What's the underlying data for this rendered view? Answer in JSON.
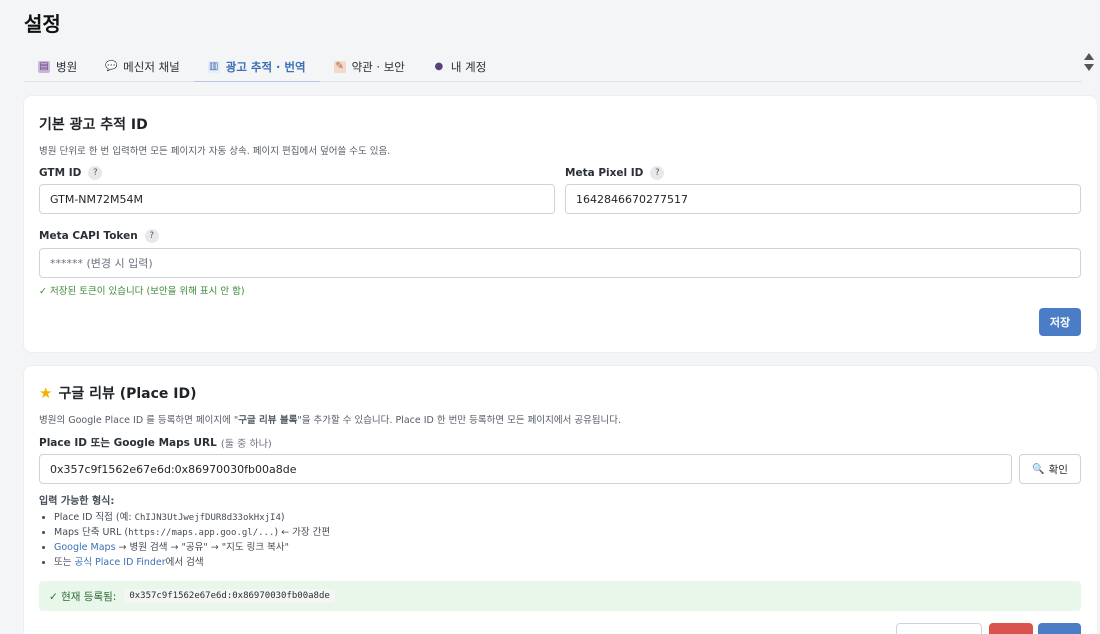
{
  "page": {
    "title": "설정"
  },
  "tabs": [
    {
      "label": "병원",
      "icon": "hospital-icon",
      "active": false
    },
    {
      "label": "메신저 채널",
      "icon": "chat-icon",
      "active": false
    },
    {
      "label": "광고 추적 · 번역",
      "icon": "chart-icon",
      "active": true
    },
    {
      "label": "약관 · 보안",
      "icon": "document-icon",
      "active": false
    },
    {
      "label": "내 계정",
      "icon": "user-icon",
      "active": false
    }
  ],
  "ad_tracking": {
    "title": "기본 광고 추적 ID",
    "description": "병원 단위로 한 번 입력하면 모든 페이지가 자동 상속. 페이지 편집에서 덮어쓸 수도 있음.",
    "gtm": {
      "label": "GTM ID",
      "help": "?",
      "value": "GTM-NM72M54M"
    },
    "meta_pixel": {
      "label": "Meta Pixel ID",
      "help": "?",
      "value": "1642846670277517"
    },
    "meta_capi": {
      "label": "Meta CAPI Token",
      "help": "?",
      "placeholder": "****** (변경 시 입력)"
    },
    "saved_hint": "✓ 저장된 토큰이 있습니다 (보안을 위해 표시 안 함)",
    "save_label": "저장"
  },
  "google_review": {
    "title": "구글 리뷰 (Place ID)",
    "description_before": "병원의 Google Place ID 를 등록하면 페이지에 \"",
    "description_bold": "구글 리뷰 블록",
    "description_after": "\"을 추가할 수 있습니다. Place ID 한 번만 등록하면 모든 페이지에서 공유됩니다.",
    "field_label": "Place ID 또는 Google Maps URL",
    "field_label_note": "(둘 중 하나)",
    "value": "0x357c9f1562e67e6d:0x86970030fb00a8de",
    "confirm_label": "확인",
    "formats_title": "입력 가능한 형식:",
    "formats": {
      "f1_text": "Place ID 직접 (예: ",
      "f1_code": "ChIJN3UtJwejfDUR8d33okHxjI4",
      "f1_end": ")",
      "f2_text": "Maps 단축 URL (",
      "f2_code": "https://maps.app.goo.gl/...",
      "f2_end": ") ← 가장 간편",
      "f3_link": "Google Maps",
      "f3_text": " → 병원 검색 → \"공유\" → \"지도 링크 복사\"",
      "f4_text1": "또는 ",
      "f4_link": "공식 Place ID Finder",
      "f4_text2": "에서 검색"
    },
    "current_label": "✓ 현재 등록됨:",
    "current_value": "0x357c9f1562e67e6d:0x86970030fb00a8de"
  },
  "colors": {
    "accent": "#4a7dc5",
    "danger": "#d9534f",
    "success_bg": "#e9f7ea"
  }
}
